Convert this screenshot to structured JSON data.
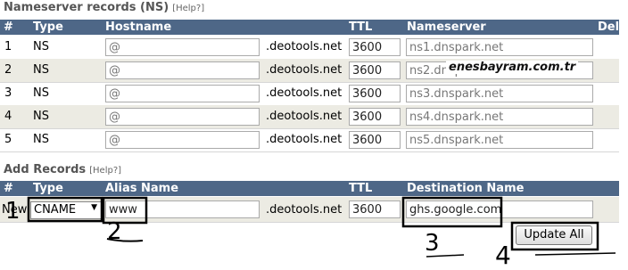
{
  "ns_section": {
    "title": "Nameserver records (NS)",
    "help": "[Help?]",
    "columns": {
      "num": "#",
      "type": "Type",
      "hostname": "Hostname",
      "ttl": "TTL",
      "nameserver": "Nameserver",
      "del": "Del"
    },
    "rows": [
      {
        "num": "1",
        "type": "NS",
        "host": "@",
        "suffix": ".deotools.net",
        "ttl": "3600",
        "nameserver": "ns1.dnspark.net"
      },
      {
        "num": "2",
        "type": "NS",
        "host": "@",
        "suffix": ".deotools.net",
        "ttl": "3600",
        "nameserver": "ns2.dnspark.net"
      },
      {
        "num": "3",
        "type": "NS",
        "host": "@",
        "suffix": ".deotools.net",
        "ttl": "3600",
        "nameserver": "ns3.dnspark.net"
      },
      {
        "num": "4",
        "type": "NS",
        "host": "@",
        "suffix": ".deotools.net",
        "ttl": "3600",
        "nameserver": "ns4.dnspark.net"
      },
      {
        "num": "5",
        "type": "NS",
        "host": "@",
        "suffix": ".deotools.net",
        "ttl": "3600",
        "nameserver": "ns5.dnspark.net"
      }
    ]
  },
  "watermark": "enesbayram.com.tr",
  "add_section": {
    "title": "Add Records",
    "help": "[Help?]",
    "columns": {
      "num": "#",
      "type": "Type",
      "alias": "Alias Name",
      "ttl": "TTL",
      "destination": "Destination Name"
    },
    "new_row": {
      "num": "New",
      "type_selected": "CNAME",
      "alias": "www",
      "suffix": ".deotools.net",
      "ttl": "3600",
      "destination": "ghs.google.com"
    },
    "update_button": "Update All"
  },
  "annotations": {
    "n1": "1",
    "n2": "2",
    "n3": "3",
    "n4": "4"
  }
}
